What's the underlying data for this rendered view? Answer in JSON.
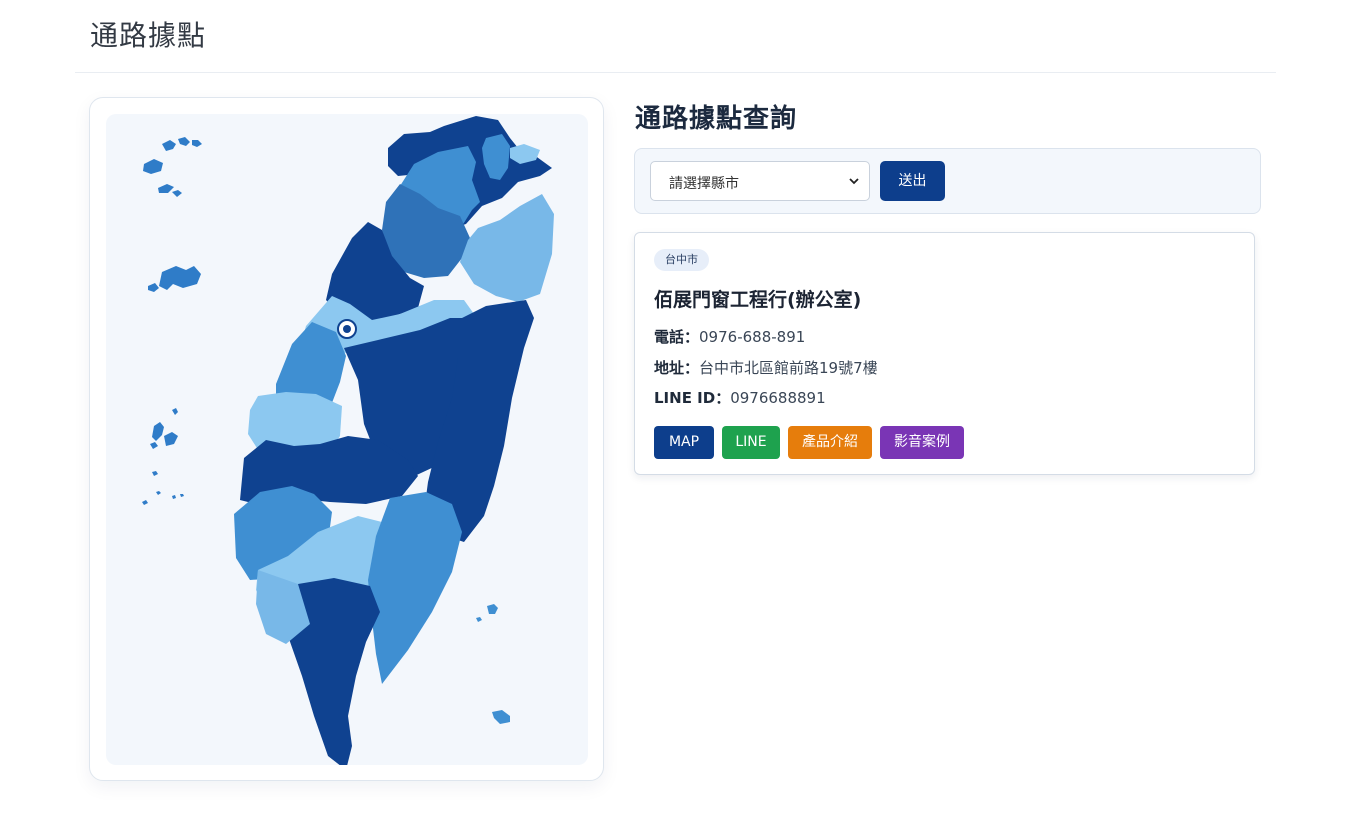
{
  "header": {
    "title": "通路據點"
  },
  "query": {
    "title": "通路據點查詢",
    "select_placeholder": "請選擇縣市",
    "submit_label": "送出"
  },
  "store": {
    "city_badge": "台中市",
    "name": "佰展門窗工程行(辦公室)",
    "phone_label": "電話：",
    "phone": "0976-688-891",
    "address_label": "地址：",
    "address": "台中市北區館前路19號7樓",
    "line_label": "LINE ID：",
    "line_id": "0976688891",
    "buttons": {
      "map": "MAP",
      "line": "LINE",
      "product": "產品介紹",
      "video": "影音案例"
    }
  },
  "colors": {
    "brand_dark": "#0d3e8c",
    "line_green": "#1ea24e",
    "product_orange": "#e67d0c",
    "video_purple": "#7a35b5",
    "map_light": "#8cc8f0",
    "map_mid": "#3f8fd2",
    "map_dark": "#0f4290"
  },
  "icons": {
    "map_marker": "location-pin-icon",
    "select_arrow": "chevron-down-icon"
  }
}
